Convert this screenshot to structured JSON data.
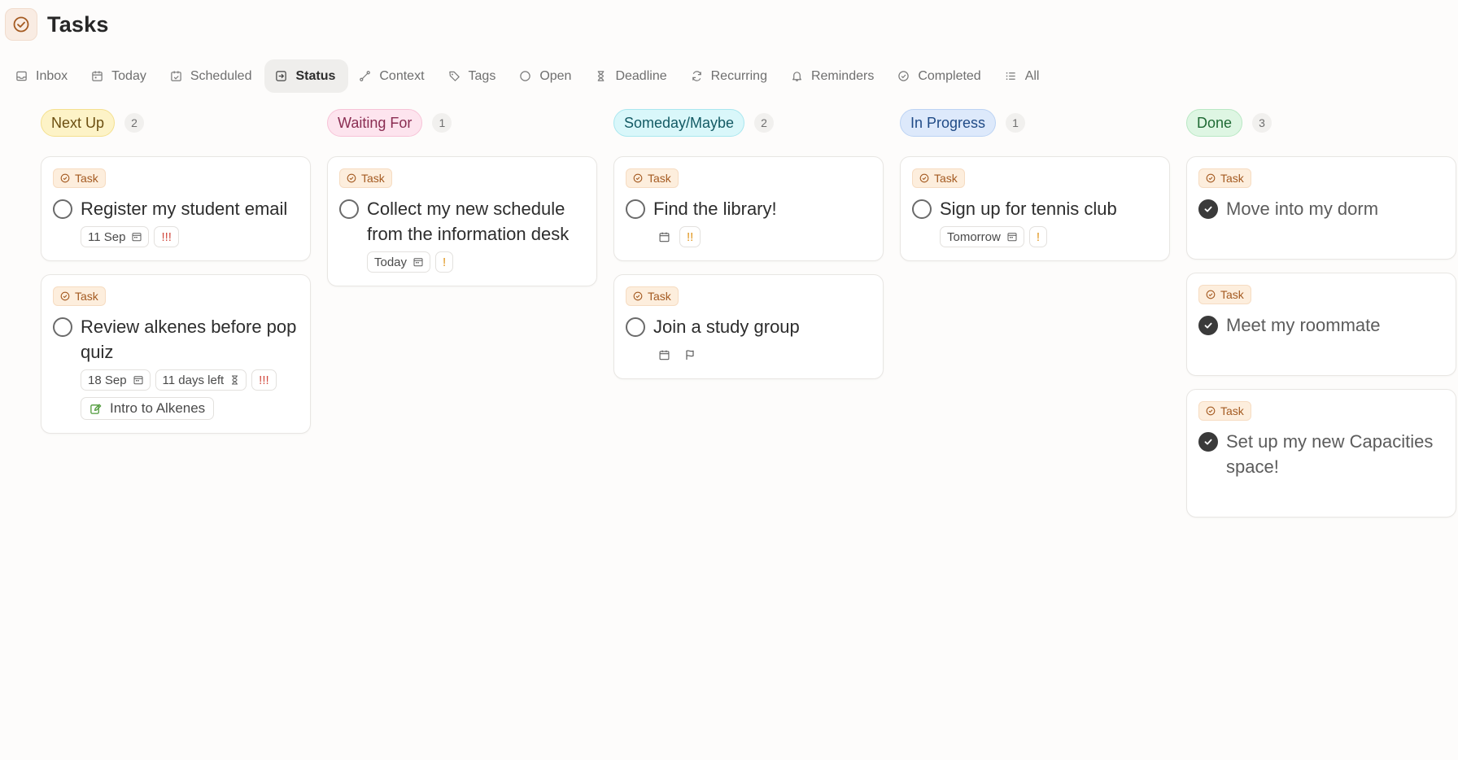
{
  "app": {
    "title": "Tasks",
    "icon": "check-circle-icon",
    "accent": "#a45a21"
  },
  "tabs": [
    {
      "id": "inbox",
      "label": "Inbox",
      "icon": "inbox-icon",
      "active": false
    },
    {
      "id": "today",
      "label": "Today",
      "icon": "calendar-icon",
      "active": false
    },
    {
      "id": "scheduled",
      "label": "Scheduled",
      "icon": "calendar-check-icon",
      "active": false
    },
    {
      "id": "status",
      "label": "Status",
      "icon": "status-icon",
      "active": true
    },
    {
      "id": "context",
      "label": "Context",
      "icon": "route-icon",
      "active": false
    },
    {
      "id": "tags",
      "label": "Tags",
      "icon": "tag-icon",
      "active": false
    },
    {
      "id": "open",
      "label": "Open",
      "icon": "circle-icon",
      "active": false
    },
    {
      "id": "deadline",
      "label": "Deadline",
      "icon": "hourglass-icon",
      "active": false
    },
    {
      "id": "recurring",
      "label": "Recurring",
      "icon": "refresh-icon",
      "active": false
    },
    {
      "id": "reminders",
      "label": "Reminders",
      "icon": "bell-icon",
      "active": false
    },
    {
      "id": "completed",
      "label": "Completed",
      "icon": "check-circle-icon",
      "active": false
    },
    {
      "id": "all",
      "label": "All",
      "icon": "list-icon",
      "active": false
    }
  ],
  "columns": [
    {
      "label": "Next Up",
      "count": "2",
      "bg": "#fdf3c7",
      "border": "#f4e08f",
      "color": "#6b4e10",
      "cards": [
        {
          "type": "Task",
          "title": "Register my student email",
          "done": false,
          "date": "11 Sep",
          "priority": "!!!",
          "priority_level": "high"
        },
        {
          "type": "Task",
          "title": "Review alkenes before pop quiz",
          "done": false,
          "date": "18 Sep",
          "deadline": "11 days left",
          "priority": "!!!",
          "priority_level": "high",
          "link": "Intro to Alkenes"
        }
      ]
    },
    {
      "label": "Waiting For",
      "count": "1",
      "bg": "#fde4ee",
      "border": "#f7c3d7",
      "color": "#8a2d52",
      "cards": [
        {
          "type": "Task",
          "title": "Collect my new schedule from the information desk",
          "done": false,
          "date": "Today",
          "priority": "!",
          "priority_level": "low"
        }
      ]
    },
    {
      "label": "Someday/Maybe",
      "count": "2",
      "bg": "#d9f7fa",
      "border": "#a9e7ef",
      "color": "#135a64",
      "cards": [
        {
          "type": "Task",
          "title": "Find the library!",
          "done": false,
          "date_icon_only": true,
          "priority": "!!",
          "priority_level": "medium"
        },
        {
          "type": "Task",
          "title": "Join a study group",
          "done": false,
          "date_icon_only": true,
          "flag_icon": true
        }
      ]
    },
    {
      "label": "In Progress",
      "count": "1",
      "bg": "#dde9fb",
      "border": "#bcd3f4",
      "color": "#1f4a86",
      "cards": [
        {
          "type": "Task",
          "title": "Sign up for tennis club",
          "done": false,
          "date": "Tomorrow",
          "priority": "!",
          "priority_level": "low"
        }
      ]
    },
    {
      "label": "Done",
      "count": "3",
      "bg": "#def6e3",
      "border": "#b9e8c4",
      "color": "#1f6a34",
      "cards": [
        {
          "type": "Task",
          "title": "Move into my dorm",
          "done": true
        },
        {
          "type": "Task",
          "title": "Meet my roommate",
          "done": true
        },
        {
          "type": "Task",
          "title": "Set up my new Capacities space!",
          "done": true
        }
      ]
    }
  ]
}
